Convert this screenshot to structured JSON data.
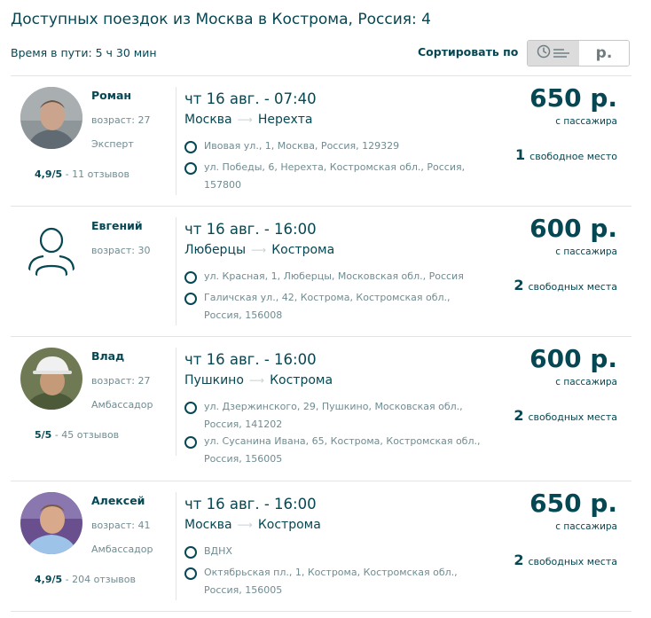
{
  "header": {
    "title": "Доступных поездок из Москва в Кострома, Россия: 4",
    "duration": "Время в пути: 5 ч 30 мин",
    "sort_label": "Сортировать по",
    "sort_price_label": "р.",
    "sort_time_icon": "clock-icon"
  },
  "trips": [
    {
      "driver": "Роман",
      "age": "возраст: 27",
      "level": "Эксперт",
      "rating_score": "4,9/5",
      "rating_reviews": " - 11 отзывов",
      "datetime": "чт 16 авг. - 07:40",
      "from": "Москва",
      "to": "Нерехта",
      "pickup": "Ивовая ул., 1, Москва, Россия, 129329",
      "dropoff": "ул. Победы, 6, Нерехта, Костромская обл., Россия, 157800",
      "price": "650 р.",
      "per_passenger": "с пассажира",
      "seats_count": "1",
      "seats_text": "свободное место"
    },
    {
      "driver": "Евгений",
      "age": "возраст: 30",
      "level": "",
      "rating_score": "",
      "rating_reviews": "",
      "datetime": "чт 16 авг. - 16:00",
      "from": "Люберцы",
      "to": "Кострома",
      "pickup": "ул. Красная, 1, Люберцы, Московская обл., Россия",
      "dropoff": "Галичская ул., 42, Кострома, Костромская обл., Россия, 156008",
      "price": "600 р.",
      "per_passenger": "с пассажира",
      "seats_count": "2",
      "seats_text": "свободных места"
    },
    {
      "driver": "Влад",
      "age": "возраст: 27",
      "level": "Амбассадор",
      "rating_score": "5/5",
      "rating_reviews": " - 45 отзывов",
      "datetime": "чт 16 авг. - 16:00",
      "from": "Пушкино",
      "to": "Кострома",
      "pickup": "ул. Дзержинского, 29, Пушкино, Московская обл., Россия, 141202",
      "dropoff": "ул. Сусанина Ивана, 65, Кострома, Костромская обл., Россия, 156005",
      "price": "600 р.",
      "per_passenger": "с пассажира",
      "seats_count": "2",
      "seats_text": "свободных места"
    },
    {
      "driver": "Алексей",
      "age": "возраст: 41",
      "level": "Амбассадор",
      "rating_score": "4,9/5",
      "rating_reviews": " - 204 отзывов",
      "datetime": "чт 16 авг. - 16:00",
      "from": "Москва",
      "to": "Кострома",
      "pickup": "ВДНХ",
      "dropoff": "Октябрьская пл., 1, Кострома, Костромская обл., Россия, 156005",
      "price": "650 р.",
      "per_passenger": "с пассажира",
      "seats_count": "2",
      "seats_text": "свободных места"
    }
  ],
  "colors": {
    "primary": "#054752",
    "secondary": "#6f8c91",
    "divider": "#e4e4e4",
    "toggle_active": "#dcdcdc"
  }
}
